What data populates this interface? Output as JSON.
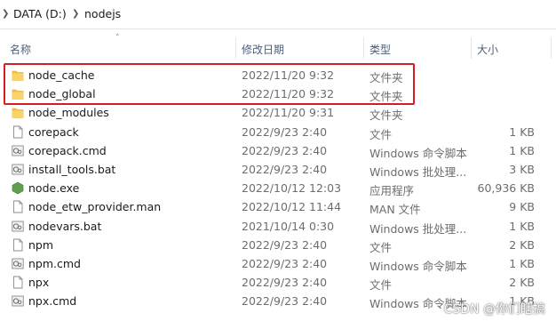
{
  "breadcrumb": {
    "items": [
      "DATA (D:)",
      "nodejs"
    ]
  },
  "columns": {
    "name": "名称",
    "modified": "修改日期",
    "type": "类型",
    "size": "大小"
  },
  "files": [
    {
      "name": "node_cache",
      "modified": "2022/11/20 9:32",
      "type": "文件夹",
      "size": "",
      "icon": "folder-icon"
    },
    {
      "name": "node_global",
      "modified": "2022/11/20 9:32",
      "type": "文件夹",
      "size": "",
      "icon": "folder-icon"
    },
    {
      "name": "node_modules",
      "modified": "2022/11/20 9:31",
      "type": "文件夹",
      "size": "",
      "icon": "folder-icon"
    },
    {
      "name": "corepack",
      "modified": "2022/9/23 2:40",
      "type": "文件",
      "size": "1 KB",
      "icon": "file-icon"
    },
    {
      "name": "corepack.cmd",
      "modified": "2022/9/23 2:40",
      "type": "Windows 命令脚本",
      "size": "1 KB",
      "icon": "script-icon"
    },
    {
      "name": "install_tools.bat",
      "modified": "2022/9/23 2:40",
      "type": "Windows 批处理...",
      "size": "3 KB",
      "icon": "script-icon"
    },
    {
      "name": "node.exe",
      "modified": "2022/10/12 12:03",
      "type": "应用程序",
      "size": "60,936 KB",
      "icon": "node-exe-icon"
    },
    {
      "name": "node_etw_provider.man",
      "modified": "2022/10/12 11:44",
      "type": "MAN 文件",
      "size": "9 KB",
      "icon": "file-icon"
    },
    {
      "name": "nodevars.bat",
      "modified": "2021/10/14 0:30",
      "type": "Windows 批处理...",
      "size": "1 KB",
      "icon": "script-icon"
    },
    {
      "name": "npm",
      "modified": "2022/9/23 2:40",
      "type": "文件",
      "size": "2 KB",
      "icon": "file-icon"
    },
    {
      "name": "npm.cmd",
      "modified": "2022/9/23 2:40",
      "type": "Windows 命令脚本",
      "size": "1 KB",
      "icon": "script-icon"
    },
    {
      "name": "npx",
      "modified": "2022/9/23 2:40",
      "type": "文件",
      "size": "2 KB",
      "icon": "file-icon"
    },
    {
      "name": "npx.cmd",
      "modified": "2022/9/23 2:40",
      "type": "Windows 命令脚本",
      "size": "1 KB",
      "icon": "script-icon"
    }
  ],
  "colors": {
    "highlight": "#d11f26",
    "folder": "#f4c243",
    "node_exe": "#5fa04e"
  },
  "watermark": "CSDN @你们瞎搞"
}
